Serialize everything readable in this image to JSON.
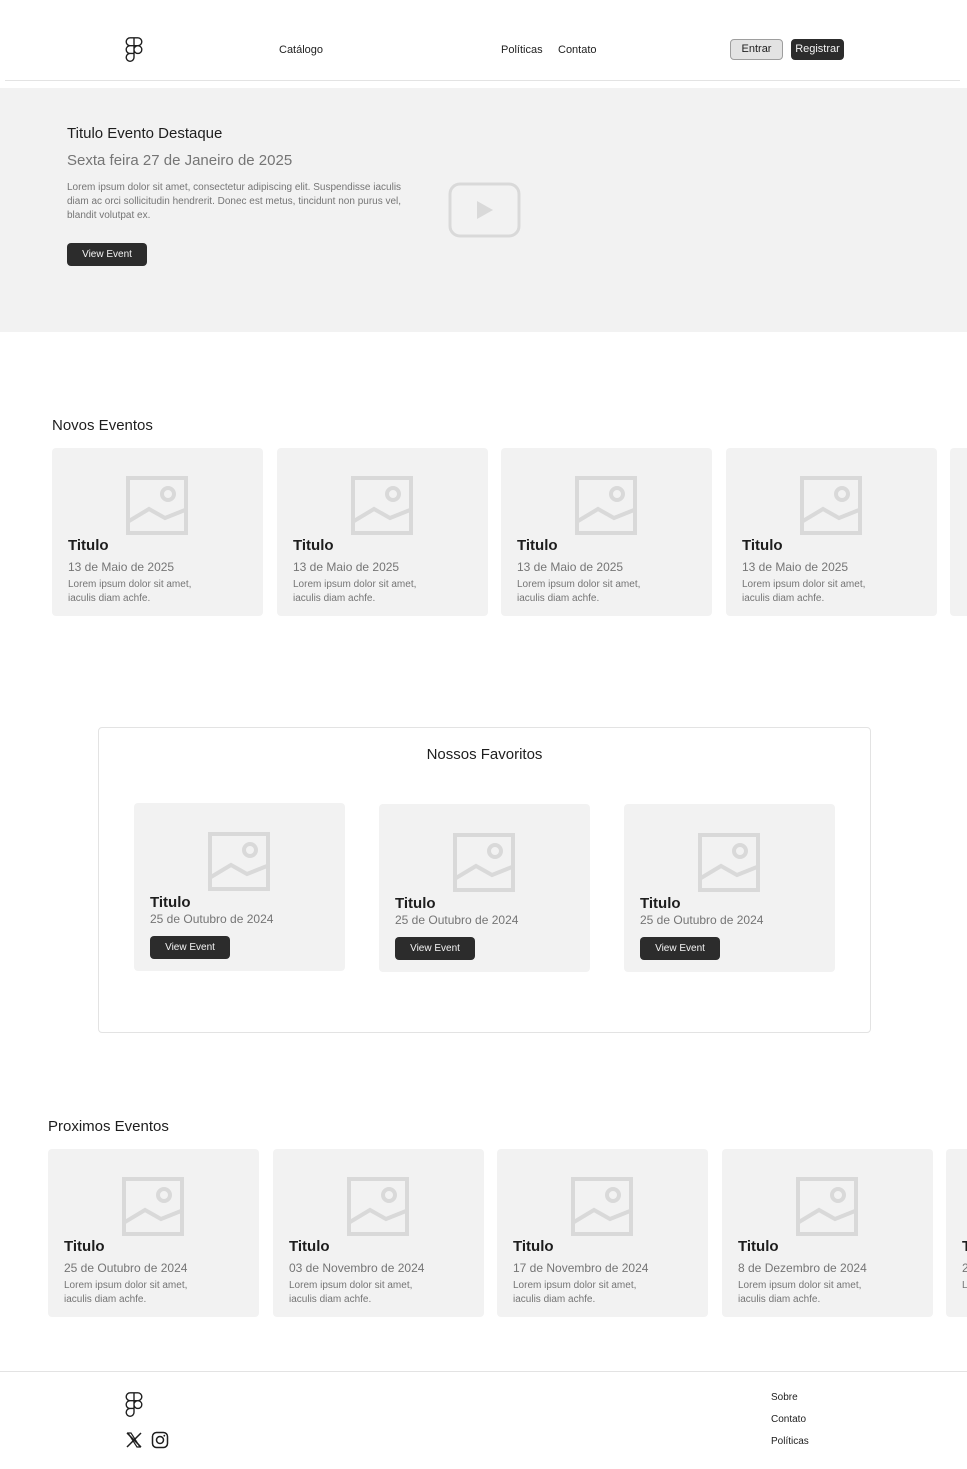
{
  "header": {
    "nav_left": "Catálogo",
    "nav_politicas": "Políticas",
    "nav_contato": "Contato",
    "btn_entrar": "Entrar",
    "btn_registrar": "Registrar"
  },
  "hero": {
    "title": "Titulo Evento Destaque",
    "date": "Sexta feira 27 de Janeiro de 2025",
    "text": "Lorem ipsum dolor sit amet, consectetur adipiscing elit. Suspendisse iaculis diam ac orci sollicitudin hendrerit. Donec est metus, tincidunt non purus vel, blandit volutpat ex.",
    "button": "View Event"
  },
  "novos": {
    "title": "Novos Eventos",
    "cards": [
      {
        "title": "Titulo",
        "date": "13 de Maio de 2025",
        "desc": "Lorem ipsum dolor sit amet, iaculis diam achfe."
      },
      {
        "title": "Titulo",
        "date": "13 de Maio de 2025",
        "desc": "Lorem ipsum dolor sit amet, iaculis diam achfe."
      },
      {
        "title": "Titulo",
        "date": "13 de Maio de 2025",
        "desc": "Lorem ipsum dolor sit amet, iaculis diam achfe."
      },
      {
        "title": "Titulo",
        "date": "13 de Maio de 2025",
        "desc": "Lorem ipsum dolor sit amet, iaculis diam achfe."
      }
    ]
  },
  "favoritos": {
    "title": "Nossos Favoritos",
    "cards": [
      {
        "title": "Titulo",
        "date": "25 de Outubro de 2024",
        "button": "View Event"
      },
      {
        "title": "Titulo",
        "date": "25 de Outubro de 2024",
        "button": "View Event"
      },
      {
        "title": "Titulo",
        "date": "25 de Outubro de 2024",
        "button": "View Event"
      }
    ]
  },
  "proximos": {
    "title": "Proximos Eventos",
    "cards": [
      {
        "title": "Titulo",
        "date": "25 de Outubro de 2024",
        "desc": "Lorem ipsum dolor sit amet, iaculis diam achfe."
      },
      {
        "title": "Titulo",
        "date": "03 de Novembro de 2024",
        "desc": "Lorem ipsum dolor sit amet, iaculis diam achfe."
      },
      {
        "title": "Titulo",
        "date": "17 de Novembro de 2024",
        "desc": "Lorem ipsum dolor sit amet, iaculis diam achfe."
      },
      {
        "title": "Titulo",
        "date": "8 de Dezembro de 2024",
        "desc": "Lorem ipsum dolor sit amet, iaculis diam achfe."
      },
      {
        "title": "T",
        "date": "2",
        "desc": "L i"
      }
    ]
  },
  "footer": {
    "links": [
      "Sobre",
      "Contato",
      "Políticas"
    ]
  },
  "icons": {
    "logo": "figma-logo-icon",
    "play": "play-icon",
    "image": "image-placeholder-icon",
    "x": "x-icon",
    "instagram": "instagram-icon"
  },
  "colors": {
    "dark": "#2c2c2c",
    "muted": "#757575",
    "card_bg": "#f2f2f2",
    "placeholder": "#d9d9d9"
  }
}
